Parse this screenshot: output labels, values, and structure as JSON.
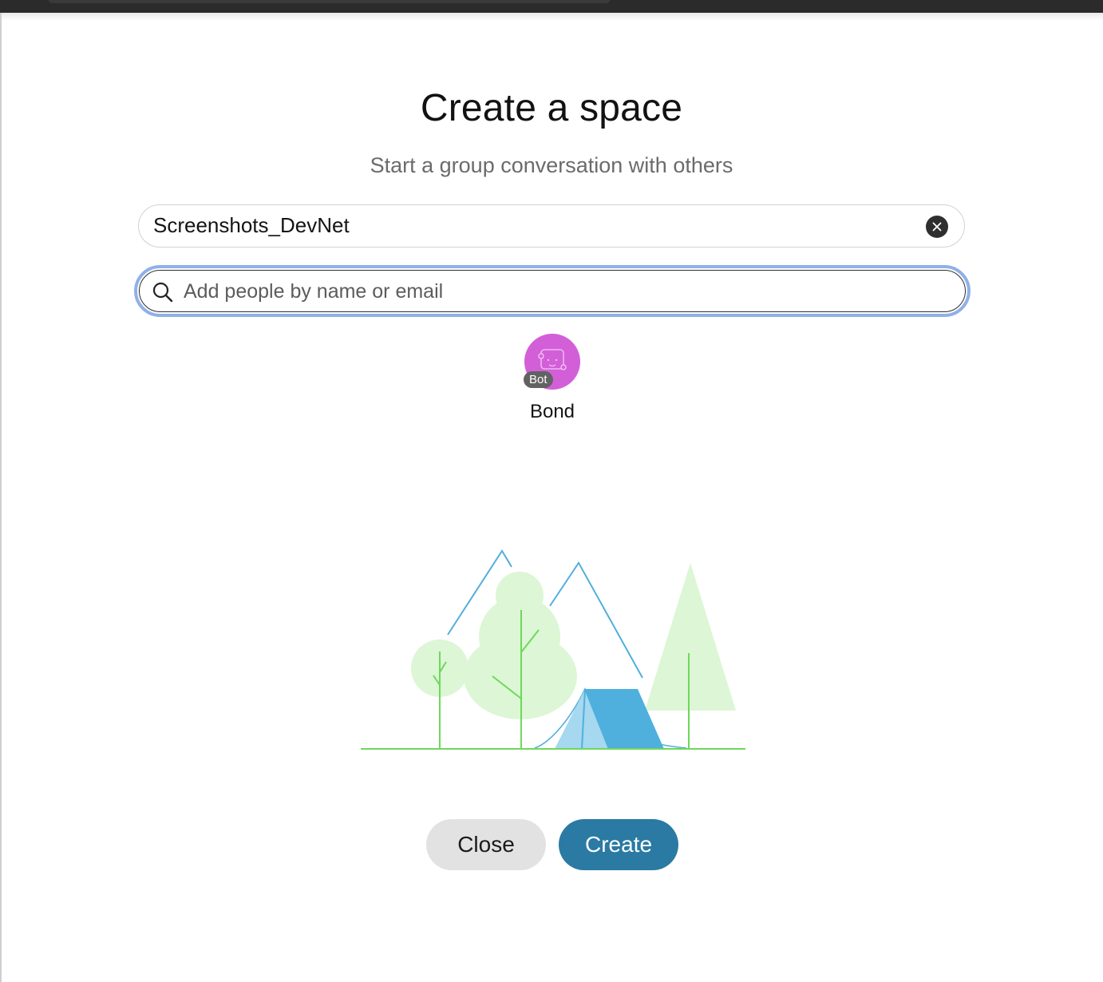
{
  "dialog": {
    "title": "Create a space",
    "subtitle": "Start a group conversation with others"
  },
  "space_name": {
    "value": "Screenshots_DevNet"
  },
  "add_people": {
    "placeholder": "Add people by name or email"
  },
  "suggested_contacts": [
    {
      "name": "Bond",
      "badge": "Bot",
      "avatar_color": "#d35fd8"
    }
  ],
  "actions": {
    "close_label": "Close",
    "create_label": "Create"
  },
  "icons": {
    "clear": "close-icon",
    "search": "search-icon",
    "bot": "bot-icon"
  },
  "colors": {
    "create_button": "#2a7aa3",
    "focus_ring": "#8fb0ea",
    "tent": "#4fb0de",
    "foliage": "#dcf6d6",
    "ground": "#6ed85a"
  }
}
